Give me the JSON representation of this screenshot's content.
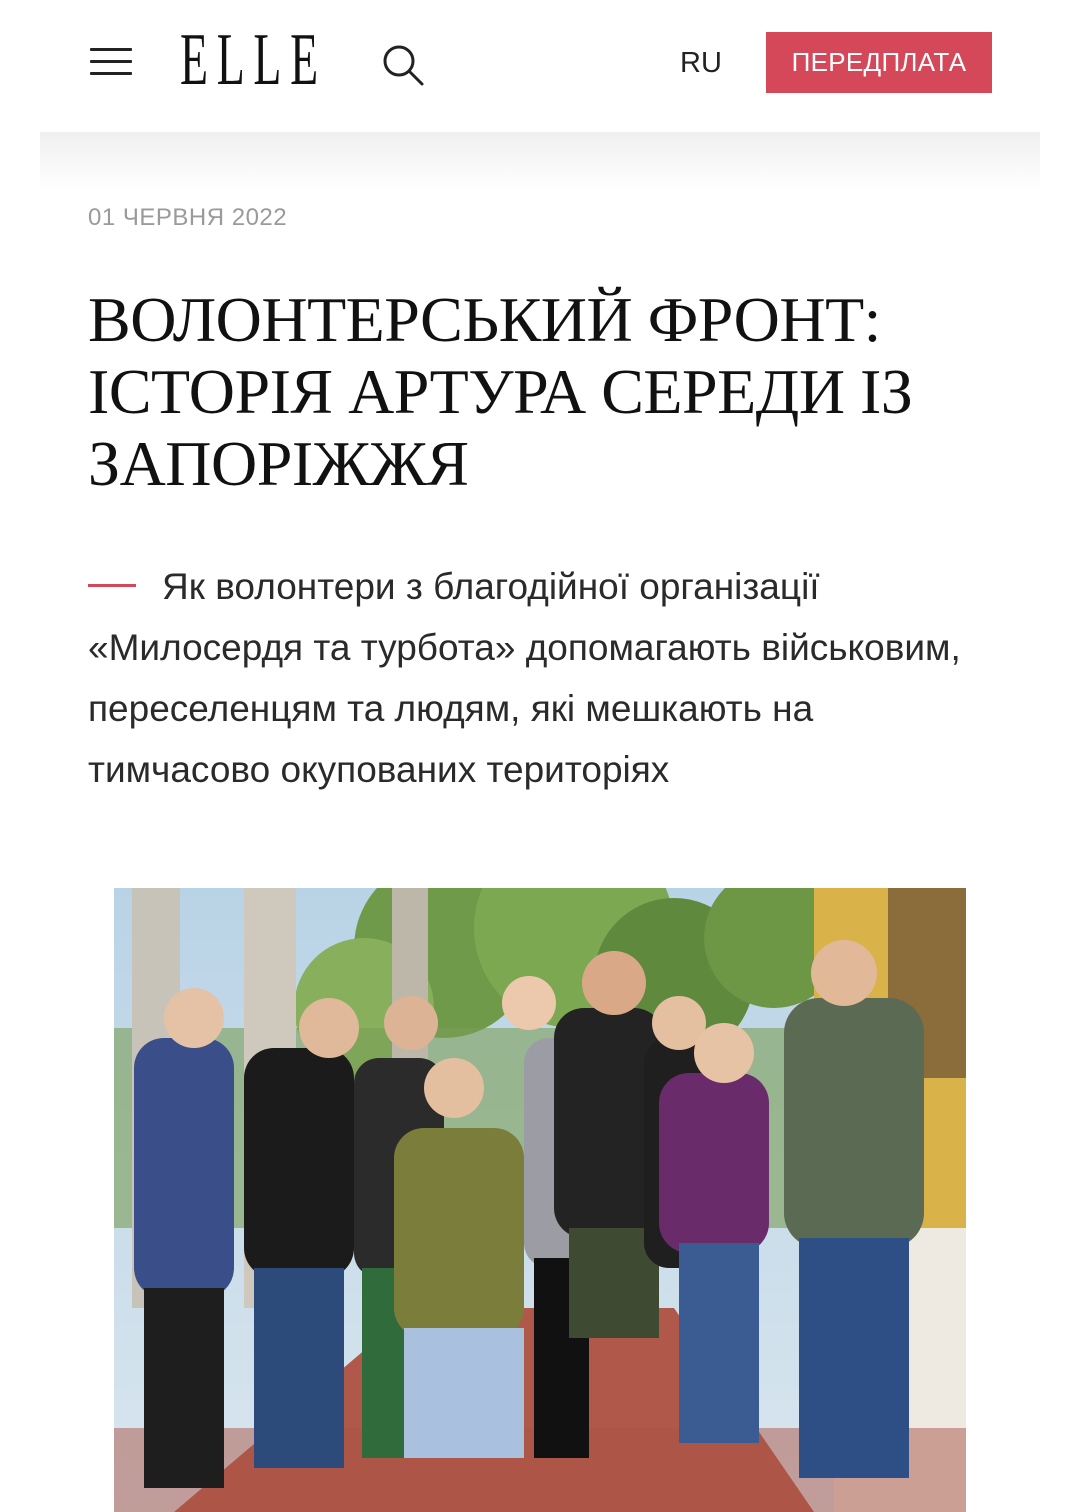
{
  "header": {
    "logo": "ELLE",
    "language": "RU",
    "subscribe_label": "ПЕРЕДПЛАТА",
    "accent_color": "#d4485a"
  },
  "article": {
    "date": "01 ЧЕРВНЯ 2022",
    "title_lines": [
      "ВОЛОНТЕРСЬКИЙ ФРОНТ:",
      "ІСТОРІЯ АРТУРА СЕРЕДИ ІЗ",
      "ЗАПОРІЖЖЯ"
    ],
    "lead": "Як волонтери з благодійної організації «Милосердя та турбота» допомагають військовим, переселенцям та людям, які мешкають на тимчасово окупованих територіях"
  },
  "icons": {
    "menu": "hamburger-menu-icon",
    "search": "search-icon"
  }
}
